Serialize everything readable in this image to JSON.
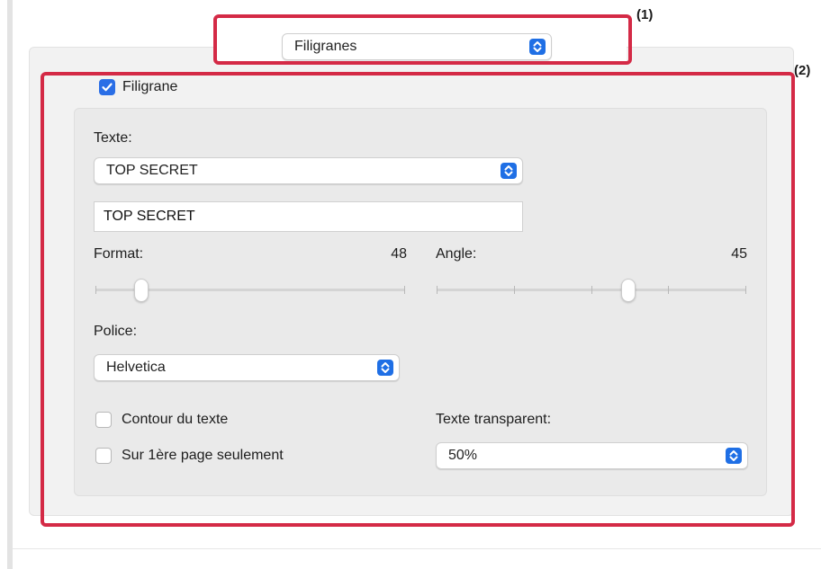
{
  "preset_popup": {
    "value": "Filigranes",
    "icon": "popup-stepper-icon"
  },
  "watermark": {
    "enable_label": "Filigrane",
    "enabled": true,
    "text_label": "Texte:",
    "text_preset": "TOP SECRET",
    "text_value": "TOP SECRET",
    "format_label": "Format:",
    "format_value": "48",
    "angle_label": "Angle:",
    "angle_value": "45",
    "font_label": "Police:",
    "font_value": "Helvetica",
    "outline_label": "Contour du texte",
    "outline_checked": false,
    "first_page_label": "Sur 1ère page seulement",
    "first_page_checked": false,
    "transparency_label": "Texte transparent:",
    "transparency_value": "50%"
  },
  "annotations": {
    "label_1": "(1)",
    "label_2": "(2)",
    "color": "#d42a46"
  },
  "colors": {
    "accent": "#1f6fe5",
    "panel": "#eaeaea"
  }
}
